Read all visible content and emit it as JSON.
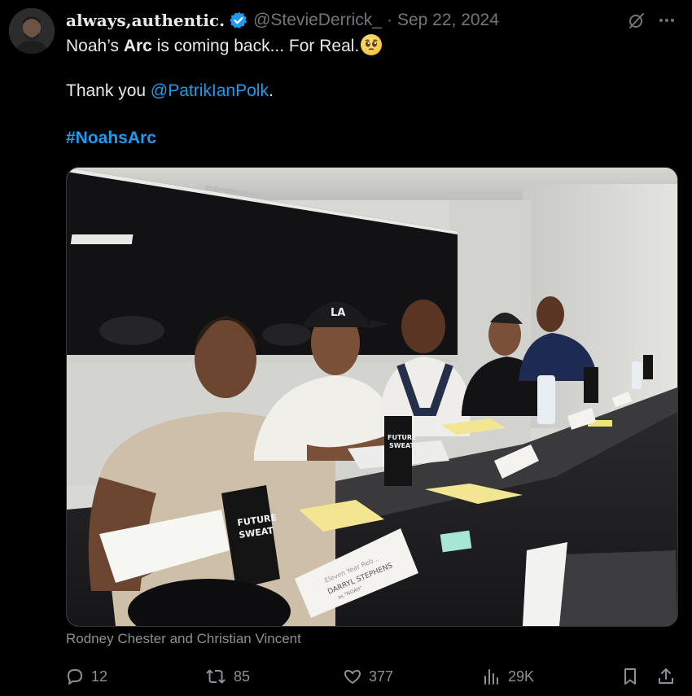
{
  "tweet": {
    "author": {
      "display_name": "always,authentic.",
      "handle": "@StevieDerrick_",
      "verified": true,
      "avatar_icon": "user-avatar"
    },
    "separator": "·",
    "date": "Sep 22, 2024",
    "text_line1_prefix": "Noah’s ",
    "text_line1_bold": "Arc",
    "text_line1_suffix": " is coming back... For Real.",
    "emoji_icon": "pleading-face-emoji",
    "thanks_prefix": "Thank you ",
    "thanks_mention": "@PatrikIanPolk",
    "thanks_suffix": ".",
    "hashtag": "#NoahsArc",
    "media_caption": "Rodney Chester and Christian Vincent",
    "photo_text": {
      "drink_brand_line1": "FUTURE",
      "drink_brand_line2": "SWEAT",
      "place_card_line1": "Eleven Year Reb...",
      "place_card_line2": "DARRYL STEPHENS",
      "place_card_line3": "as \"NOAH\"",
      "cap_logo": "LA"
    }
  },
  "actions": {
    "reply_count": "12",
    "retweet_count": "85",
    "like_count": "377",
    "views_count": "29K"
  },
  "colors": {
    "background": "#000000",
    "text": "#e7e9ea",
    "muted": "#71767b",
    "accent": "#1d9bf0"
  }
}
